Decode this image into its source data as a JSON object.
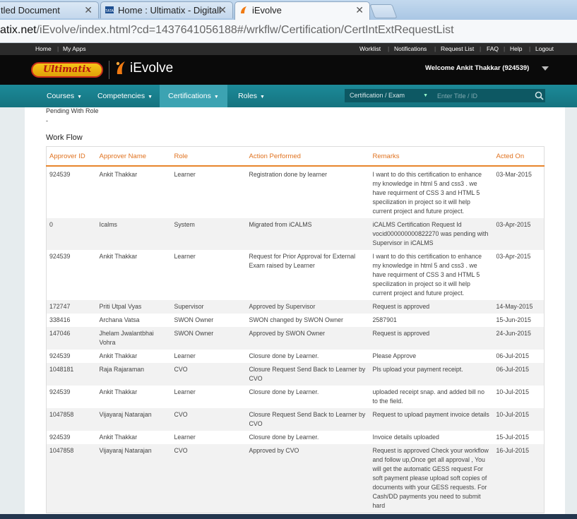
{
  "browser": {
    "tabs": [
      {
        "title": "tled Document"
      },
      {
        "title": "Home : Ultimatix - Digitall"
      },
      {
        "title": "iEvolve"
      }
    ],
    "url_domain": "atix.net",
    "url_path": "/iEvolve/index.html?cd=1437641056188#/wrkflw/Certification/CertIntExtRequestList"
  },
  "topstrip": {
    "left": [
      "Home",
      "My Apps"
    ],
    "right": [
      "Worklist",
      "Notifications",
      "Request List",
      "FAQ",
      "Help",
      "Logout"
    ]
  },
  "brand": {
    "logo": "Ultimatix",
    "app": "iEvolve",
    "welcome": "Welcome Ankit Thakkar (924539)"
  },
  "nav": {
    "items": [
      "Courses",
      "Competencies",
      "Certifications",
      "Roles"
    ],
    "active": "Certifications",
    "select_value": "Certification / Exam",
    "search_placeholder": "Enter Title / ID"
  },
  "page": {
    "pending_label": "Pending With Role",
    "pending_value": "-",
    "workflow_title": "Work Flow"
  },
  "table": {
    "headers": [
      "Approver ID",
      "Approver Name",
      "Role",
      "Action Performed",
      "Remarks",
      "Acted On"
    ],
    "rows": [
      [
        "924539",
        "Ankit Thakkar",
        "Learner",
        "Registration done by learner",
        "I want to do this certification to enhance my knowledge in html 5 and css3 . we have requirment of CSS 3 and HTML 5 specilization in project so it will help current project and future project.",
        "03-Mar-2015"
      ],
      [
        "0",
        "Icalms",
        "System",
        "Migrated from iCALMS",
        "iCALMS Certification Request Id vocid000000000822270 was pending with Supervisor in iCALMS",
        "03-Apr-2015"
      ],
      [
        "924539",
        "Ankit Thakkar",
        "Learner",
        "Request for Prior Approval for External Exam raised by Learner",
        "I want to do this certification to enhance my knowledge in html 5 and css3 . we have requirment of CSS 3 and HTML 5 specilization in project so it will help current project and future project.",
        "03-Apr-2015"
      ],
      [
        "172747",
        "Priti Utpal Vyas",
        "Supervisor",
        "Approved by Supervisor",
        "Request is approved",
        "14-May-2015"
      ],
      [
        "338416",
        "Archana Vatsa",
        "SWON Owner",
        "SWON changed by SWON Owner",
        "2587901",
        "15-Jun-2015"
      ],
      [
        "147046",
        "Jhelam Jwalantbhai Vohra",
        "SWON Owner",
        "Approved by SWON Owner",
        "Request is approved",
        "24-Jun-2015"
      ],
      [
        "924539",
        "Ankit Thakkar",
        "Learner",
        "Closure done by Learner.",
        "Please Approve",
        "06-Jul-2015"
      ],
      [
        "1048181",
        "Raja Rajaraman",
        "CVO",
        "Closure Request Send Back to Learner by CVO",
        "Pls upload your payment receipt.",
        "06-Jul-2015"
      ],
      [
        "924539",
        "Ankit Thakkar",
        "Learner",
        "Closure done by Learner.",
        "uploaded receipt snap. and added bill no to the field.",
        "10-Jul-2015"
      ],
      [
        "1047858",
        "Vijayaraj Natarajan",
        "CVO",
        "Closure Request Send Back to Learner by CVO",
        "Request to upload payment invoice details",
        "10-Jul-2015"
      ],
      [
        "924539",
        "Ankit Thakkar",
        "Learner",
        "Closure done by Learner.",
        "Invoice details uploaded",
        "15-Jul-2015"
      ],
      [
        "1047858",
        "Vijayaraj Natarajan",
        "CVO",
        "Approved by CVO",
        "Request is approved Check your workflow and follow up,Once get all approval , You will get the automatic GESS request For soft payment please upload soft copies of documents with your GESS requests. For Cash/DD payments you need to submit hard",
        "16-Jul-2015"
      ]
    ]
  }
}
